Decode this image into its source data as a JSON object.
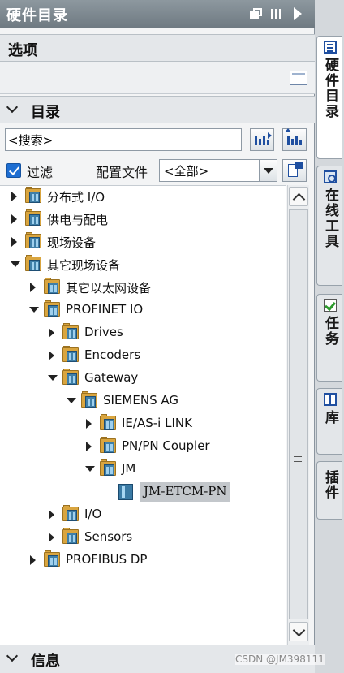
{
  "panel": {
    "title": "硬件目录",
    "options_section": {
      "title": "选项"
    },
    "catalog_section": {
      "title": "目录"
    },
    "info_section": {
      "title": "信息"
    }
  },
  "search": {
    "value": "<搜索>"
  },
  "filter": {
    "label": "过滤",
    "checked": true
  },
  "profile": {
    "label": "配置文件",
    "selected": "<全部>"
  },
  "tree": [
    {
      "label": "分布式 I/O",
      "level": 0,
      "toggle": "collapsed",
      "icon": "folder-icon"
    },
    {
      "label": "供电与配电",
      "level": 0,
      "toggle": "collapsed",
      "icon": "folder-icon"
    },
    {
      "label": "现场设备",
      "level": 0,
      "toggle": "collapsed",
      "icon": "folder-icon"
    },
    {
      "label": "其它现场设备",
      "level": 0,
      "toggle": "expanded",
      "icon": "folder-icon"
    },
    {
      "label": "其它以太网设备",
      "level": 1,
      "toggle": "collapsed",
      "icon": "folder-icon"
    },
    {
      "label": "PROFINET IO",
      "level": 1,
      "toggle": "expanded",
      "icon": "folder-icon"
    },
    {
      "label": "Drives",
      "level": 2,
      "toggle": "collapsed",
      "icon": "folder-icon"
    },
    {
      "label": "Encoders",
      "level": 2,
      "toggle": "collapsed",
      "icon": "folder-icon"
    },
    {
      "label": "Gateway",
      "level": 2,
      "toggle": "expanded",
      "icon": "folder-icon"
    },
    {
      "label": "SIEMENS AG",
      "level": 3,
      "toggle": "expanded",
      "icon": "folder-icon"
    },
    {
      "label": "IE/AS-i LINK",
      "level": 4,
      "toggle": "collapsed",
      "icon": "folder-icon"
    },
    {
      "label": "PN/PN Coupler",
      "level": 4,
      "toggle": "collapsed",
      "icon": "folder-icon"
    },
    {
      "label": "JM",
      "level": 4,
      "toggle": "expanded",
      "icon": "folder-icon"
    },
    {
      "label": "JM-ETCM-PN",
      "level": 5,
      "toggle": "none",
      "icon": "device-icon",
      "selected": true
    },
    {
      "label": "I/O",
      "level": 2,
      "toggle": "collapsed",
      "icon": "folder-icon"
    },
    {
      "label": "Sensors",
      "level": 2,
      "toggle": "collapsed",
      "icon": "folder-icon"
    },
    {
      "label": "PROFIBUS DP",
      "level": 1,
      "toggle": "collapsed",
      "icon": "folder-icon"
    }
  ],
  "side_tabs": [
    {
      "label": "硬件目录",
      "icon": "catalog-icon",
      "active": true
    },
    {
      "label": "在线工具",
      "icon": "online-tools-icon",
      "active": false
    },
    {
      "label": "任务",
      "icon": "tasks-icon",
      "active": false
    },
    {
      "label": "库",
      "icon": "library-icon",
      "active": false
    },
    {
      "label": "插件",
      "icon": "",
      "active": false
    }
  ],
  "watermark": "CSDN @JM398111"
}
